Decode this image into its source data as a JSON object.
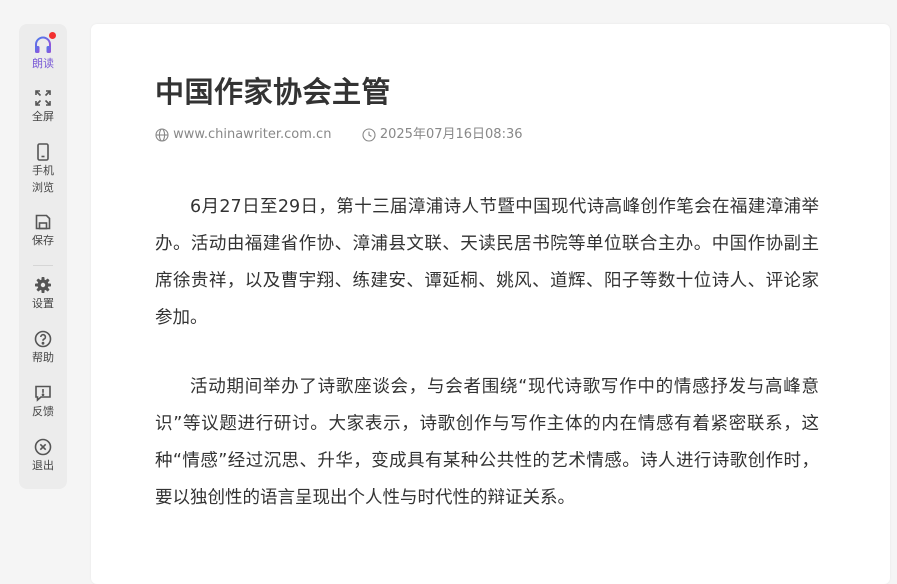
{
  "sidebar": {
    "items": [
      {
        "label": "朗读",
        "icon": "headphones-icon",
        "active": true,
        "badge": true
      },
      {
        "label": "全屏",
        "icon": "fullscreen-icon"
      },
      {
        "label": "手机\n浏览",
        "label_line1": "手机",
        "label_line2": "浏览",
        "icon": "mobile-icon"
      },
      {
        "label": "保存",
        "icon": "save-icon"
      },
      {
        "label": "设置",
        "icon": "gear-icon"
      },
      {
        "label": "帮助",
        "icon": "help-icon"
      },
      {
        "label": "反馈",
        "icon": "feedback-icon"
      },
      {
        "label": "退出",
        "icon": "close-circle-icon"
      }
    ],
    "active_color": "#7b5cd6",
    "badge_color": "#f23030"
  },
  "article": {
    "title": "中国作家协会主管",
    "source": "www.chinawriter.com.cn",
    "datetime": "2025年07月16日08:36",
    "paragraphs": [
      "6月27日至29日，第十三届漳浦诗人节暨中国现代诗高峰创作笔会在福建漳浦举办。活动由福建省作协、漳浦县文联、天读民居书院等单位联合主办。中国作协副主席徐贵祥，以及曹宇翔、练建安、谭延桐、姚风、道辉、阳子等数十位诗人、评论家参加。",
      "活动期间举办了诗歌座谈会，与会者围绕“现代诗歌写作中的情感抒发与高峰意识”等议题进行研讨。大家表示，诗歌创作与写作主体的内在情感有着紧密联系，这种“情感”经过沉思、升华，变成具有某种公共性的艺术情感。诗人进行诗歌创作时，要以独创性的语言呈现出个人性与时代性的辩证关系。"
    ]
  }
}
